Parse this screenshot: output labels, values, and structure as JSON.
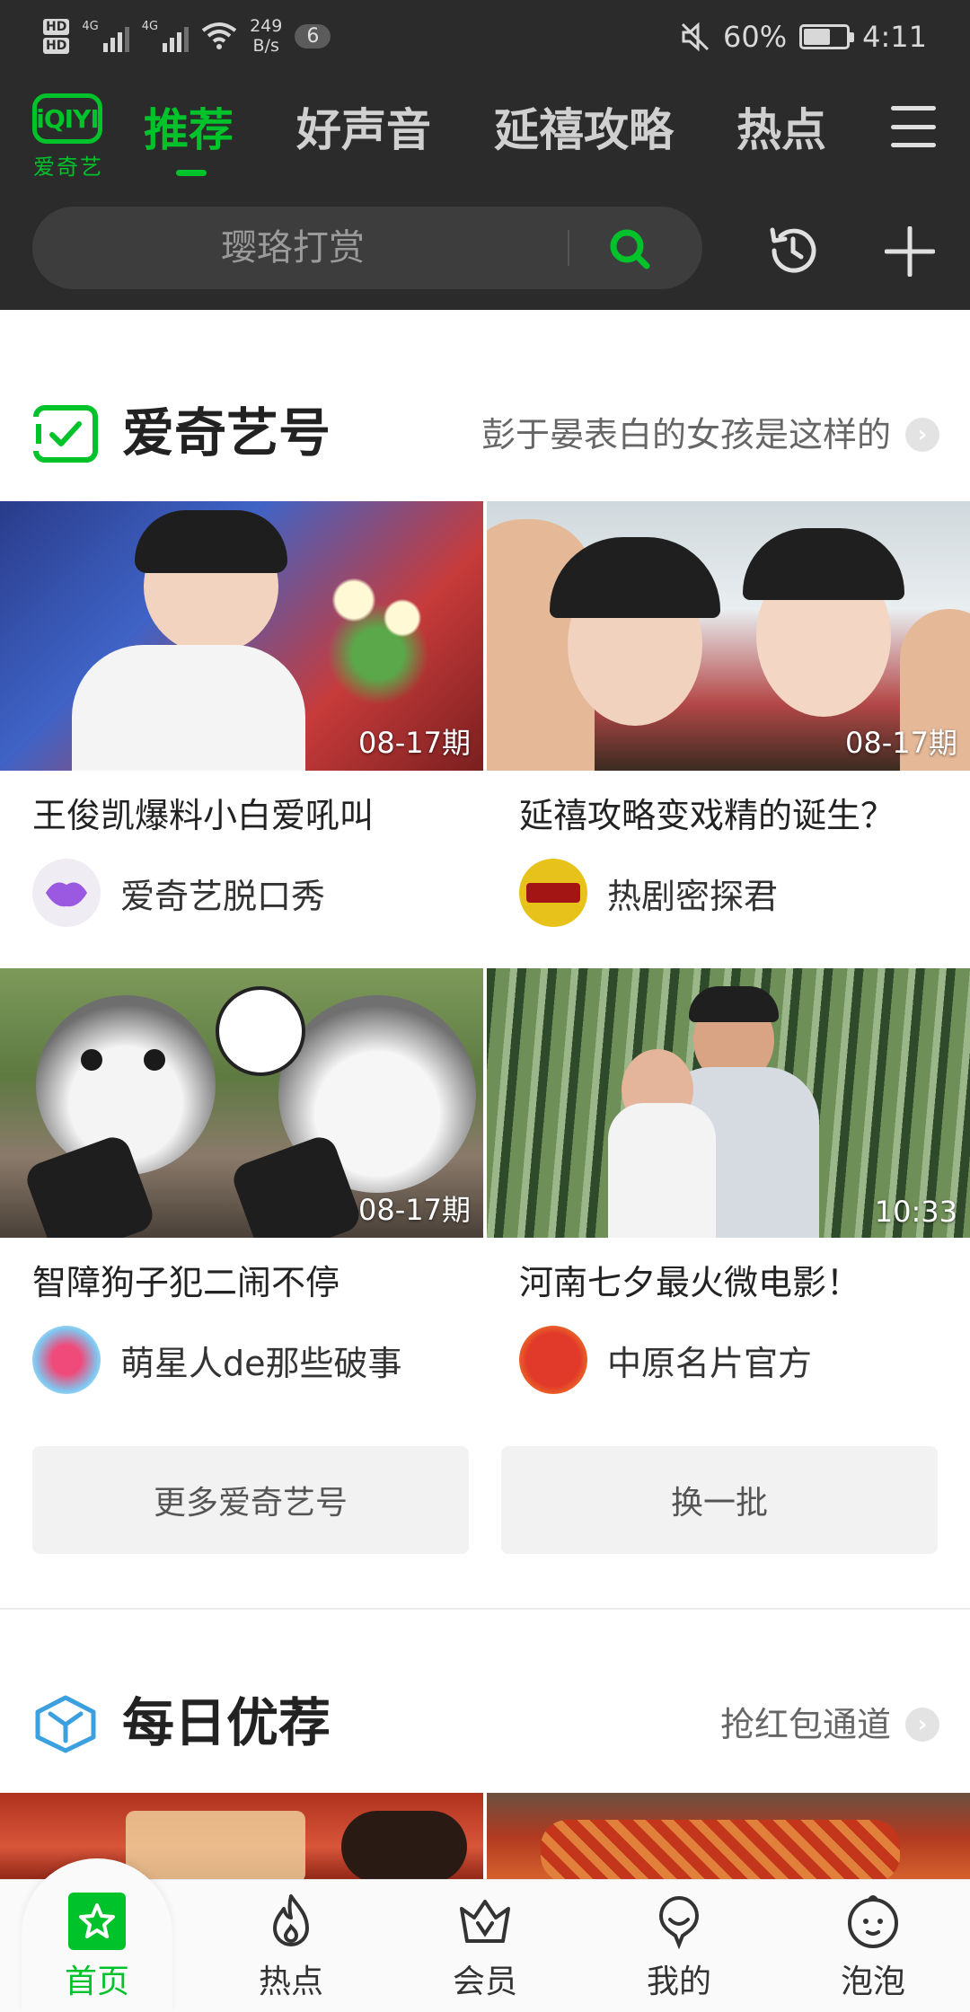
{
  "status_bar": {
    "hd1": "HD",
    "hd2": "HD",
    "sig1": "4G",
    "sig2": "4G",
    "speed_value": "249",
    "speed_unit": "B/s",
    "notification_count": "6",
    "battery": "60%",
    "battery_level": 0.6,
    "time": "4:11"
  },
  "app": {
    "logo_mark": "iQIYI",
    "logo_text": "爱奇艺",
    "brand_color": "#00c22a"
  },
  "nav": {
    "tabs": [
      {
        "label": "推荐",
        "active": true
      },
      {
        "label": "好声音",
        "active": false
      },
      {
        "label": "延禧攻略",
        "active": false
      },
      {
        "label": "热点",
        "active": false
      }
    ]
  },
  "search": {
    "placeholder": "璎珞打赏"
  },
  "section1": {
    "title": "爱奇艺号",
    "more": "彭于晏表白的女孩是这样的",
    "cards": [
      {
        "tag": "08-17期",
        "title": "王俊凯爆料小白爱吼叫",
        "author": "爱奇艺脱口秀"
      },
      {
        "tag": "08-17期",
        "title": "延禧攻略变戏精的诞生？",
        "author": "热剧密探君"
      },
      {
        "tag": "08-17期",
        "title": "智障狗子犯二闹不停",
        "author": "萌星人de那些破事"
      },
      {
        "tag": "10:33",
        "title": "河南七夕最火微电影！",
        "author": "中原名片官方"
      }
    ],
    "buttons": {
      "more_label": "更多爱奇艺号",
      "refresh_label": "换一批"
    }
  },
  "section2": {
    "title": "每日优荐",
    "more": "抢红包通道"
  },
  "bottom_nav": [
    {
      "label": "首页",
      "icon": "home-icon",
      "active": true
    },
    {
      "label": "热点",
      "icon": "flame-icon",
      "active": false
    },
    {
      "label": "会员",
      "icon": "crown-icon",
      "active": false
    },
    {
      "label": "我的",
      "icon": "profile-icon",
      "active": false
    },
    {
      "label": "泡泡",
      "icon": "bubble-face-icon",
      "active": false
    }
  ]
}
